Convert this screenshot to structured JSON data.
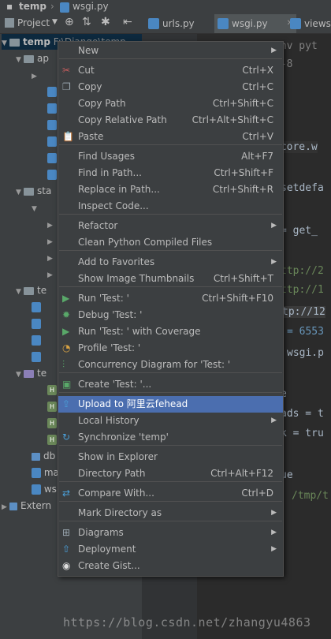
{
  "titlebar": {
    "project_crumb": "temp",
    "file_crumb": "wsgi.py"
  },
  "toolbar": {
    "project_label": "Project"
  },
  "tabs": [
    {
      "label": "urls.py"
    },
    {
      "label": "wsgi.py"
    },
    {
      "label": "views"
    }
  ],
  "tree": {
    "root_label": "temp",
    "root_path": "F:\\Django\\temp",
    "items": [
      "ap",
      "sta",
      "te",
      "te",
      "db",
      "ma",
      "ws",
      "Extern"
    ]
  },
  "editor": {
    "lines": [
      "env pyt",
      "f-8",
      ".core.w",
      "setdefa",
      "= get_",
      "ttp://2",
      "ttp://1",
      "tp://12",
      "= 6553",
      "wsgi.p",
      "e",
      "ads = t",
      "k = tru",
      "ue",
      "/tmp/t"
    ]
  },
  "menu": {
    "items": [
      {
        "label": "New",
        "shortcut": "",
        "submenu": true,
        "icon": ""
      },
      {
        "label": "Cut",
        "shortcut": "Ctrl+X",
        "submenu": false,
        "icon": "scissors-icon"
      },
      {
        "label": "Copy",
        "shortcut": "Ctrl+C",
        "submenu": false,
        "icon": "copy-icon"
      },
      {
        "label": "Copy Path",
        "shortcut": "Ctrl+Shift+C",
        "submenu": false,
        "icon": ""
      },
      {
        "label": "Copy Relative Path",
        "shortcut": "Ctrl+Alt+Shift+C",
        "submenu": false,
        "icon": ""
      },
      {
        "label": "Paste",
        "shortcut": "Ctrl+V",
        "submenu": false,
        "icon": "paste-icon"
      },
      {
        "label": "Find Usages",
        "shortcut": "Alt+F7",
        "submenu": false,
        "icon": ""
      },
      {
        "label": "Find in Path...",
        "shortcut": "Ctrl+Shift+F",
        "submenu": false,
        "icon": ""
      },
      {
        "label": "Replace in Path...",
        "shortcut": "Ctrl+Shift+R",
        "submenu": false,
        "icon": ""
      },
      {
        "label": "Inspect Code...",
        "shortcut": "",
        "submenu": false,
        "icon": ""
      },
      {
        "label": "Refactor",
        "shortcut": "",
        "submenu": true,
        "icon": ""
      },
      {
        "label": "Clean Python Compiled Files",
        "shortcut": "",
        "submenu": false,
        "icon": ""
      },
      {
        "label": "Add to Favorites",
        "shortcut": "",
        "submenu": true,
        "icon": ""
      },
      {
        "label": "Show Image Thumbnails",
        "shortcut": "Ctrl+Shift+T",
        "submenu": false,
        "icon": ""
      },
      {
        "label": "Run 'Test: '",
        "shortcut": "Ctrl+Shift+F10",
        "submenu": false,
        "icon": "run-icon"
      },
      {
        "label": "Debug 'Test: '",
        "shortcut": "",
        "submenu": false,
        "icon": "debug-icon"
      },
      {
        "label": "Run 'Test: ' with Coverage",
        "shortcut": "",
        "submenu": false,
        "icon": "coverage-icon"
      },
      {
        "label": "Profile 'Test: '",
        "shortcut": "",
        "submenu": false,
        "icon": "profile-icon"
      },
      {
        "label": "Concurrency Diagram for 'Test: '",
        "shortcut": "",
        "submenu": false,
        "icon": "concurrency-icon"
      },
      {
        "label": "Create 'Test: '...",
        "shortcut": "",
        "submenu": false,
        "icon": "create-config-icon"
      },
      {
        "label": "Upload to 阿里云fehead",
        "shortcut": "",
        "submenu": false,
        "icon": "upload-icon"
      },
      {
        "label": "Local History",
        "shortcut": "",
        "submenu": true,
        "icon": ""
      },
      {
        "label": "Synchronize 'temp'",
        "shortcut": "",
        "submenu": false,
        "icon": "sync-icon"
      },
      {
        "label": "Show in Explorer",
        "shortcut": "",
        "submenu": false,
        "icon": ""
      },
      {
        "label": "Directory Path",
        "shortcut": "Ctrl+Alt+F12",
        "submenu": false,
        "icon": ""
      },
      {
        "label": "Compare With...",
        "shortcut": "Ctrl+D",
        "submenu": false,
        "icon": "compare-icon"
      },
      {
        "label": "Mark Directory as",
        "shortcut": "",
        "submenu": true,
        "icon": ""
      },
      {
        "label": "Diagrams",
        "shortcut": "",
        "submenu": true,
        "icon": "diagram-icon"
      },
      {
        "label": "Deployment",
        "shortcut": "",
        "submenu": true,
        "icon": "deployment-icon"
      },
      {
        "label": "Create Gist...",
        "shortcut": "",
        "submenu": false,
        "icon": "github-icon"
      }
    ]
  },
  "watermark": "https://blog.csdn.net/zhangyu4863",
  "colors": {
    "selection": "#4b6eaf",
    "menu_bg": "#3c3f41",
    "editor_bg": "#2b2b2b"
  }
}
